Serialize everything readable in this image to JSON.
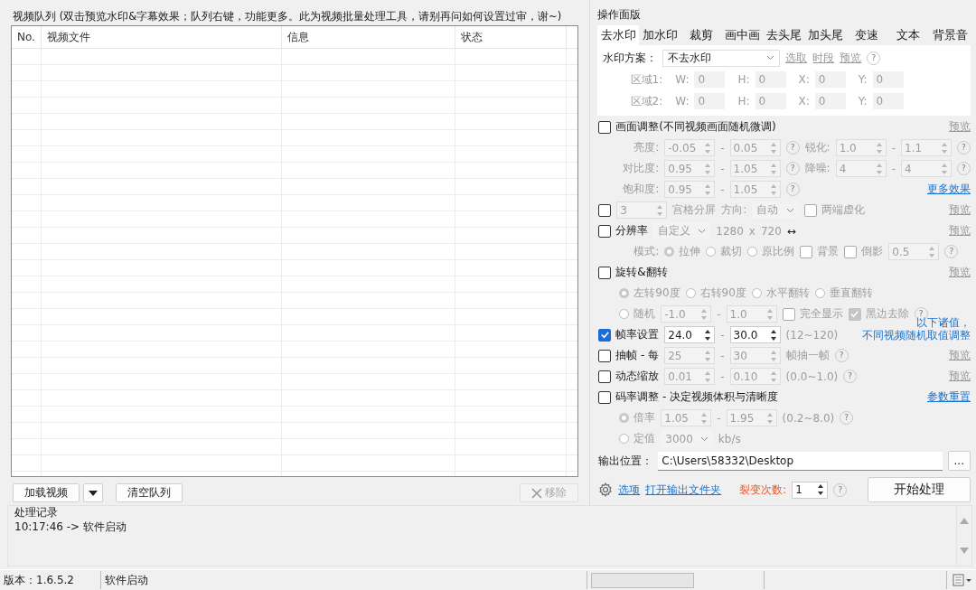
{
  "queue": {
    "title": "视频队列 (双击预览水印&字幕效果；队列右键，功能更多。此为视频批量处理工具，请别再问如何设置过审，谢~)",
    "columns": [
      "No.",
      "视频文件",
      "信息",
      "状态"
    ]
  },
  "queue_buttons": {
    "load": "加载视频",
    "clear": "清空队列",
    "remove": {
      "label": "移除",
      "disabled": true
    }
  },
  "panel": {
    "title": "操作面版",
    "tabs": [
      {
        "label": "去水印",
        "selected": true
      },
      {
        "label": "加水印",
        "selected": false
      },
      {
        "label": "裁剪",
        "selected": false
      },
      {
        "label": "画中画",
        "selected": false
      },
      {
        "label": "去头尾",
        "selected": false
      },
      {
        "label": "加头尾",
        "selected": false
      },
      {
        "label": "变速",
        "selected": false
      },
      {
        "label": "文本",
        "selected": false
      },
      {
        "label": "背景音",
        "selected": false
      }
    ],
    "watermark": {
      "rows": [
        {
          "items": [
            {
              "kind": "text",
              "text": "水印方案：",
              "disabled": false
            },
            {
              "kind": "select",
              "value": "不去水印",
              "disabled": false
            },
            {
              "kind": "link",
              "text": "选取",
              "disabled": true
            },
            {
              "kind": "link",
              "text": "时段",
              "disabled": true
            },
            {
              "kind": "link",
              "text": "预览",
              "disabled": true
            },
            {
              "kind": "help",
              "text": "?"
            }
          ]
        },
        {
          "indent": true,
          "items": [
            {
              "kind": "text",
              "text": "区域1:",
              "disabled": true
            },
            {
              "kind": "text",
              "text": "W:",
              "disabled": true
            },
            {
              "kind": "field",
              "value": "0",
              "disabled": true
            },
            {
              "kind": "text",
              "text": "H:",
              "disabled": true
            },
            {
              "kind": "field",
              "value": "0",
              "disabled": true
            },
            {
              "kind": "text",
              "text": "X:",
              "disabled": true
            },
            {
              "kind": "field",
              "value": "0",
              "disabled": true
            },
            {
              "kind": "text",
              "text": "Y:",
              "disabled": true
            },
            {
              "kind": "field",
              "value": "0",
              "disabled": true
            }
          ]
        },
        {
          "indent": true,
          "items": [
            {
              "kind": "text",
              "text": "区域2:",
              "disabled": true
            },
            {
              "kind": "text",
              "text": "W:",
              "disabled": true
            },
            {
              "kind": "field",
              "value": "0",
              "disabled": true
            },
            {
              "kind": "text",
              "text": "H:",
              "disabled": true
            },
            {
              "kind": "field",
              "value": "0",
              "disabled": true
            },
            {
              "kind": "text",
              "text": "X:",
              "disabled": true
            },
            {
              "kind": "field",
              "value": "0",
              "disabled": true
            },
            {
              "kind": "text",
              "text": "Y:",
              "disabled": true
            },
            {
              "kind": "field",
              "value": "0",
              "disabled": true
            }
          ]
        }
      ]
    },
    "rows": [
      {
        "items": [
          {
            "kind": "check",
            "label": "画面调整(不同视频画面随机微调)",
            "checked": false,
            "disabled": false
          }
        ],
        "right": [
          {
            "kind": "link",
            "text": "预览",
            "disabled": true
          }
        ]
      },
      {
        "indent": true,
        "items": [
          {
            "kind": "text",
            "text": "亮度:",
            "disabled": true
          },
          {
            "kind": "spin",
            "value": "-0.05",
            "disabled": true
          },
          {
            "kind": "sep",
            "text": "-"
          },
          {
            "kind": "spin",
            "value": "0.05",
            "disabled": true
          },
          {
            "kind": "help",
            "text": "?"
          },
          {
            "kind": "text",
            "text": "锐化:",
            "disabled": true
          },
          {
            "kind": "spin",
            "value": "1.0",
            "disabled": true
          },
          {
            "kind": "sep",
            "text": "-"
          },
          {
            "kind": "spin",
            "value": "1.1",
            "disabled": true
          },
          {
            "kind": "help",
            "text": "?"
          }
        ]
      },
      {
        "indent": true,
        "items": [
          {
            "kind": "text",
            "text": "对比度:",
            "disabled": true
          },
          {
            "kind": "spin",
            "value": "0.95",
            "disabled": true
          },
          {
            "kind": "sep",
            "text": "-"
          },
          {
            "kind": "spin",
            "value": "1.05",
            "disabled": true
          },
          {
            "kind": "help",
            "text": "?"
          },
          {
            "kind": "text",
            "text": "降噪:",
            "disabled": true
          },
          {
            "kind": "spin",
            "value": "4",
            "disabled": true
          },
          {
            "kind": "sep",
            "text": "-"
          },
          {
            "kind": "spin",
            "value": "4",
            "disabled": true
          },
          {
            "kind": "help",
            "text": "?"
          }
        ]
      },
      {
        "indent": true,
        "items": [
          {
            "kind": "text",
            "text": "饱和度:",
            "disabled": true
          },
          {
            "kind": "spin",
            "value": "0.95",
            "disabled": true
          },
          {
            "kind": "sep",
            "text": "-"
          },
          {
            "kind": "spin",
            "value": "1.05",
            "disabled": true
          },
          {
            "kind": "help",
            "text": "?"
          }
        ],
        "right": [
          {
            "kind": "link",
            "text": "更多效果",
            "disabled": false
          }
        ]
      },
      {
        "items": [
          {
            "kind": "check",
            "checked": false,
            "disabled": false
          },
          {
            "kind": "spin",
            "value": "3",
            "disabled": true
          },
          {
            "kind": "text",
            "text": "宫格分屏",
            "disabled": true
          },
          {
            "kind": "text",
            "text": "方向:",
            "disabled": true
          },
          {
            "kind": "select",
            "value": "自动",
            "disabled": true
          },
          {
            "kind": "check",
            "label": "两端虚化",
            "checked": false,
            "disabled": true
          }
        ],
        "right": [
          {
            "kind": "link",
            "text": "预览",
            "disabled": true
          }
        ]
      },
      {
        "items": [
          {
            "kind": "check",
            "label": "分辨率",
            "checked": false,
            "disabled": false
          },
          {
            "kind": "select",
            "value": "自定义",
            "disabled": true
          },
          {
            "kind": "text",
            "text": "1280",
            "disabled": true
          },
          {
            "kind": "text",
            "text": "x",
            "disabled": true
          },
          {
            "kind": "text",
            "text": "720",
            "disabled": true
          },
          {
            "kind": "text",
            "text": "↔",
            "disabled": false
          }
        ],
        "right": [
          {
            "kind": "link",
            "text": "预览",
            "disabled": true
          }
        ]
      },
      {
        "indent": true,
        "items": [
          {
            "kind": "text",
            "text": "模式:",
            "disabled": true
          },
          {
            "kind": "radio",
            "label": "拉伸",
            "selected": true,
            "disabled": true
          },
          {
            "kind": "radio",
            "label": "裁切",
            "selected": false,
            "disabled": true
          },
          {
            "kind": "radio",
            "label": "原比例",
            "selected": false,
            "disabled": true
          },
          {
            "kind": "check",
            "label": "背景",
            "checked": false,
            "disabled": true
          },
          {
            "kind": "check",
            "label": "倒影",
            "checked": false,
            "disabled": true
          },
          {
            "kind": "spin",
            "value": "0.5",
            "disabled": true
          },
          {
            "kind": "help",
            "text": "?"
          }
        ]
      },
      {
        "items": [
          {
            "kind": "check",
            "label": "旋转&翻转",
            "checked": false,
            "disabled": false
          }
        ],
        "right": [
          {
            "kind": "link",
            "text": "预览",
            "disabled": true
          }
        ]
      },
      {
        "indent": true,
        "items": [
          {
            "kind": "radio",
            "label": "左转90度",
            "selected": true,
            "disabled": true
          },
          {
            "kind": "radio",
            "label": "右转90度",
            "selected": false,
            "disabled": true
          },
          {
            "kind": "radio",
            "label": "水平翻转",
            "selected": false,
            "disabled": true
          },
          {
            "kind": "radio",
            "label": "垂直翻转",
            "selected": false,
            "disabled": true
          }
        ]
      },
      {
        "indent": true,
        "items": [
          {
            "kind": "radio",
            "label": "随机",
            "selected": false,
            "disabled": true
          },
          {
            "kind": "spin",
            "value": "-1.0",
            "disabled": true
          },
          {
            "kind": "sep",
            "text": "-"
          },
          {
            "kind": "spin",
            "value": "1.0",
            "disabled": true
          },
          {
            "kind": "check",
            "label": "完全显示",
            "checked": false,
            "disabled": true
          },
          {
            "kind": "check",
            "label": "黑边去除",
            "checked": true,
            "disabled": true
          },
          {
            "kind": "help",
            "text": "?"
          }
        ]
      },
      {
        "items": [
          {
            "kind": "check",
            "label": "帧率设置",
            "checked": true,
            "disabled": false
          },
          {
            "kind": "spin",
            "value": "24.0",
            "disabled": false
          },
          {
            "kind": "sep",
            "text": "-"
          },
          {
            "kind": "spin",
            "value": "30.0",
            "disabled": false
          },
          {
            "kind": "text",
            "text": "(12~120)",
            "disabled": true
          }
        ],
        "right": [
          {
            "kind": "note",
            "lines": [
              "以下诸值，",
              "不同视频随机取值调整"
            ]
          }
        ]
      },
      {
        "items": [
          {
            "kind": "check",
            "label": "抽帧 - 每",
            "checked": false,
            "disabled": false
          },
          {
            "kind": "spin",
            "value": "25",
            "disabled": true
          },
          {
            "kind": "sep",
            "text": "-"
          },
          {
            "kind": "spin",
            "value": "30",
            "disabled": true
          },
          {
            "kind": "text",
            "text": "帧抽一帧",
            "disabled": true
          },
          {
            "kind": "help",
            "text": "?"
          }
        ],
        "right": [
          {
            "kind": "link",
            "text": "预览",
            "disabled": true
          }
        ]
      },
      {
        "items": [
          {
            "kind": "check",
            "label": "动态缩放",
            "checked": false,
            "disabled": false
          },
          {
            "kind": "spin",
            "value": "0.01",
            "disabled": true
          },
          {
            "kind": "sep",
            "text": "-"
          },
          {
            "kind": "spin",
            "value": "0.10",
            "disabled": true
          },
          {
            "kind": "text",
            "text": "(0.0~1.0)",
            "disabled": true
          },
          {
            "kind": "help",
            "text": "?"
          }
        ],
        "right": [
          {
            "kind": "link",
            "text": "预览",
            "disabled": true
          }
        ]
      },
      {
        "items": [
          {
            "kind": "check",
            "label": "码率调整 - 决定视频体积与清晰度",
            "checked": false,
            "disabled": false
          }
        ],
        "right": [
          {
            "kind": "link",
            "text": "参数重置",
            "disabled": false
          }
        ]
      },
      {
        "indent": true,
        "items": [
          {
            "kind": "radio",
            "label": "倍率",
            "selected": true,
            "disabled": true
          },
          {
            "kind": "spin",
            "value": "1.05",
            "disabled": true
          },
          {
            "kind": "sep",
            "text": "-"
          },
          {
            "kind": "spin",
            "value": "1.95",
            "disabled": true
          },
          {
            "kind": "text",
            "text": "(0.2~8.0)",
            "disabled": true
          },
          {
            "kind": "help",
            "text": "?"
          }
        ]
      },
      {
        "indent": true,
        "items": [
          {
            "kind": "radio",
            "label": "定值",
            "selected": false,
            "disabled": true
          },
          {
            "kind": "select",
            "value": "3000",
            "disabled": true
          },
          {
            "kind": "text",
            "text": "kb/s",
            "disabled": true
          }
        ]
      }
    ],
    "output": {
      "label": "输出位置：",
      "path": "C:\\Users\\58332\\Desktop",
      "browse": "..."
    },
    "actions": {
      "options": "选项",
      "open_folder": "打开输出文件夹",
      "fission_label": "裂变次数:",
      "fission_count": "1",
      "help": "?",
      "start": "开始处理"
    }
  },
  "log": {
    "title": "处理记录",
    "lines": [
      "10:17:46 -> 软件启动"
    ]
  },
  "status_bar": {
    "version": "版本：1.6.5.2",
    "message": "软件启动",
    "progress": {
      "level": 0
    }
  }
}
